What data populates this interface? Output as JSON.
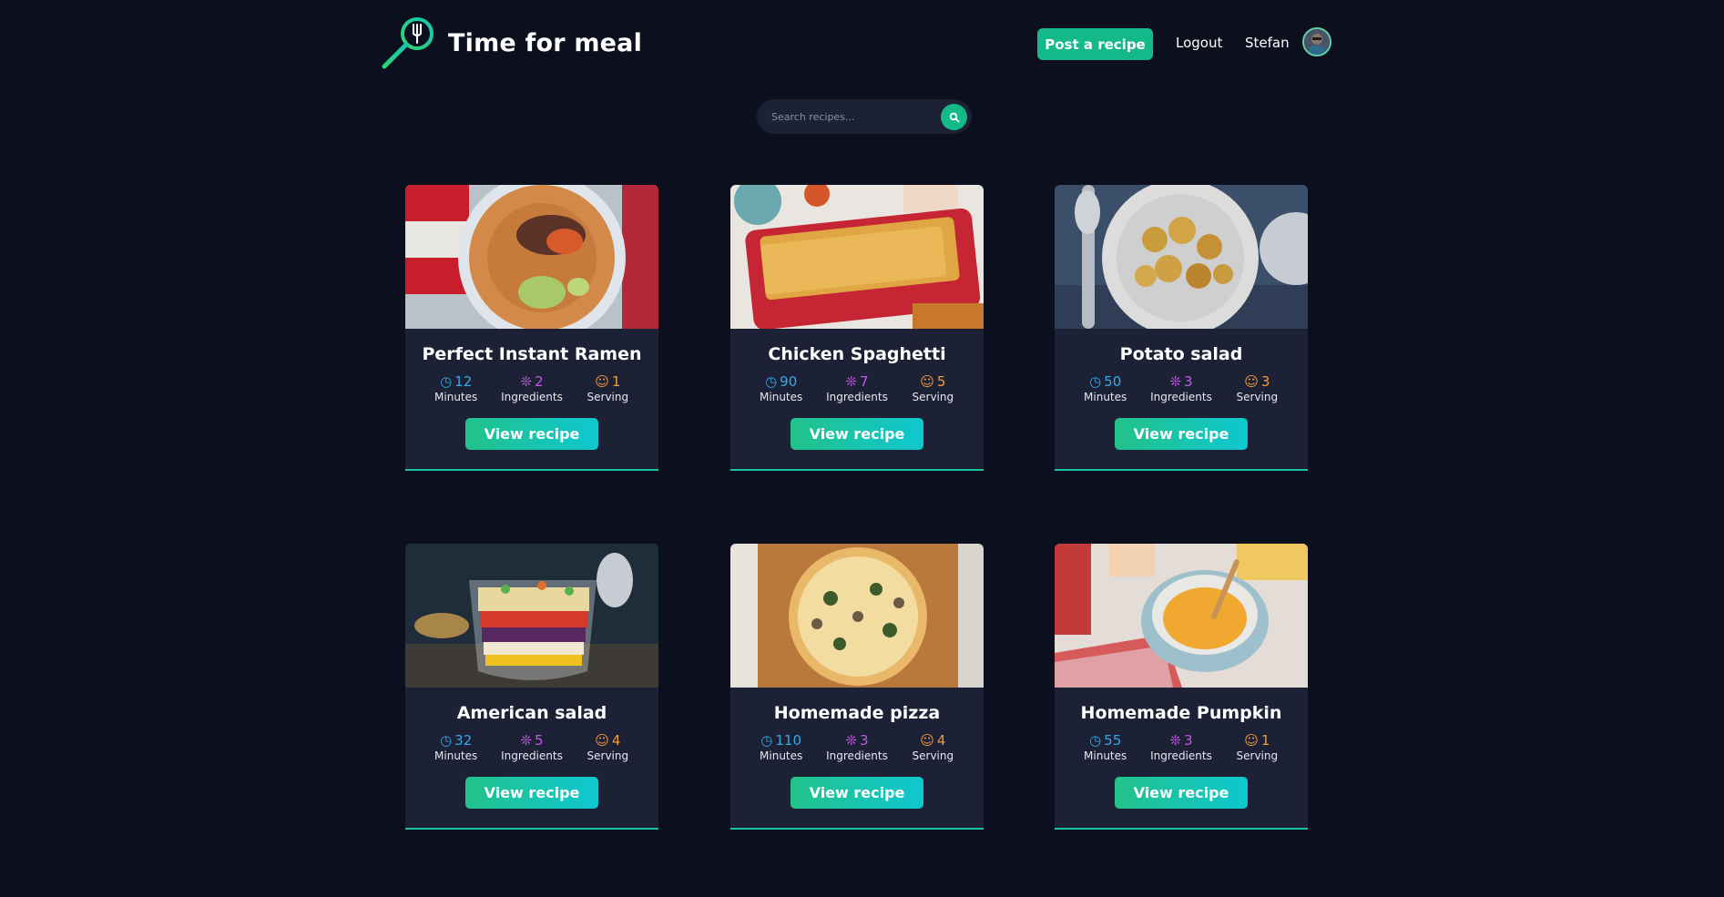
{
  "header": {
    "brand": "Time for meal",
    "post_label": "Post a recipe",
    "logout_label": "Logout",
    "username": "Stefan"
  },
  "search": {
    "placeholder": "Search recipes..."
  },
  "stat_labels": {
    "minutes": "Minutes",
    "ingredients": "Ingredients",
    "serving": "Serving"
  },
  "view_label": "View recipe",
  "recipes": [
    {
      "title": "Perfect Instant Ramen",
      "minutes": "12",
      "ingredients": "2",
      "serving": "1"
    },
    {
      "title": "Chicken Spaghetti",
      "minutes": "90",
      "ingredients": "7",
      "serving": "5"
    },
    {
      "title": "Potato salad",
      "minutes": "50",
      "ingredients": "3",
      "serving": "3"
    },
    {
      "title": "American salad",
      "minutes": "32",
      "ingredients": "5",
      "serving": "4"
    },
    {
      "title": "Homemade pizza",
      "minutes": "110",
      "ingredients": "3",
      "serving": "4"
    },
    {
      "title": "Homemade Pumpkin",
      "minutes": "55",
      "ingredients": "3",
      "serving": "1"
    }
  ],
  "colors": {
    "background": "#0c101e",
    "card": "#1c2135",
    "accent": "#14b98a",
    "minutes": "#35a9e8",
    "ingredients": "#c35ae6",
    "serving": "#f19a3e"
  }
}
